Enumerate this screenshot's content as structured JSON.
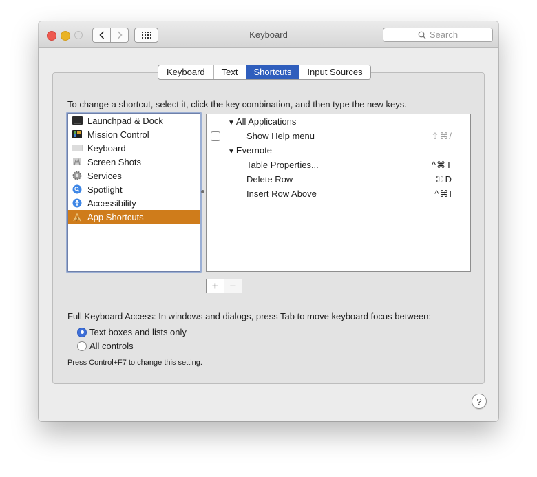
{
  "window": {
    "title": "Keyboard",
    "search_placeholder": "Search",
    "icons": {
      "close": "close-icon",
      "minimize": "minimize-icon",
      "zoom": "zoom-icon",
      "back": "chevron-left-icon",
      "forward": "chevron-right-icon",
      "show_all": "grid-icon",
      "search": "search-icon",
      "help": "help-icon"
    },
    "back_glyph": "‹",
    "forward_glyph": "›"
  },
  "tabs": [
    {
      "label": "Keyboard",
      "active": false
    },
    {
      "label": "Text",
      "active": false
    },
    {
      "label": "Shortcuts",
      "active": true
    },
    {
      "label": "Input Sources",
      "active": false
    }
  ],
  "instructions": "To change a shortcut, select it, click the key combination, and then type the new keys.",
  "categories": [
    {
      "label": "Launchpad & Dock",
      "icon": "launchpad-dock-icon",
      "selected": false
    },
    {
      "label": "Mission Control",
      "icon": "mission-control-icon",
      "selected": false
    },
    {
      "label": "Keyboard",
      "icon": "keyboard-icon",
      "selected": false
    },
    {
      "label": "Screen Shots",
      "icon": "screenshot-icon",
      "selected": false
    },
    {
      "label": "Services",
      "icon": "gear-icon",
      "selected": false
    },
    {
      "label": "Spotlight",
      "icon": "spotlight-icon",
      "selected": false
    },
    {
      "label": "Accessibility",
      "icon": "accessibility-icon",
      "selected": false
    },
    {
      "label": "App Shortcuts",
      "icon": "app-store-icon",
      "selected": true
    }
  ],
  "shortcuts": {
    "groups": [
      {
        "label": "All Applications",
        "items": [
          {
            "label": "Show Help menu",
            "keys": "⇧⌘/",
            "checkbox": true,
            "checked": false,
            "dimmed": true
          }
        ]
      },
      {
        "label": "Evernote",
        "items": [
          {
            "label": "Table Properties...",
            "keys": "^⌘T",
            "checkbox": false,
            "dimmed": false
          },
          {
            "label": "Delete Row",
            "keys": "⌘D",
            "checkbox": false,
            "dimmed": false
          },
          {
            "label": "Insert Row Above",
            "keys": "^⌘I",
            "checkbox": false,
            "dimmed": false
          }
        ]
      }
    ],
    "expand_glyph": "▼"
  },
  "buttons": {
    "add": "+",
    "remove": "−"
  },
  "full_keyboard_access": {
    "label": "Full Keyboard Access: In windows and dialogs, press Tab to move keyboard focus between:",
    "options": [
      {
        "label": "Text boxes and lists only",
        "selected": true
      },
      {
        "label": "All controls",
        "selected": false
      }
    ],
    "note": "Press Control+F7 to change this setting."
  },
  "help_glyph": "?",
  "colors": {
    "selection": "#cf7c1b",
    "active_tab": "#2f5ebd",
    "radio_on": "#3e6fd8"
  }
}
